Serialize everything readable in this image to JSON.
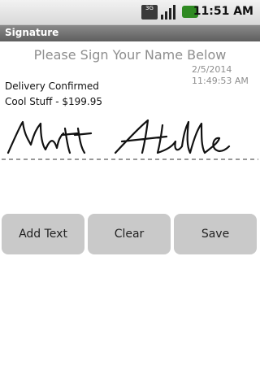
{
  "status_bar": {
    "network": "3G",
    "time": "11:51 AM"
  },
  "title_bar": {
    "title": "Signature"
  },
  "content": {
    "instruction": "Please Sign Your Name Below",
    "date": "2/5/2014",
    "time": "11:49:53 AM",
    "line1": "Delivery Confirmed",
    "line2": "Cool Stuff - $199.95"
  },
  "buttons": {
    "add_text": "Add Text",
    "clear": "Clear",
    "save": "Save"
  },
  "colors": {
    "status_bg": "#e6e6e6",
    "title_bg": "#6b6b6b",
    "text_gray": "#8e8e8e",
    "button_bg": "#c9c9c9",
    "battery": "#2f8a22"
  }
}
